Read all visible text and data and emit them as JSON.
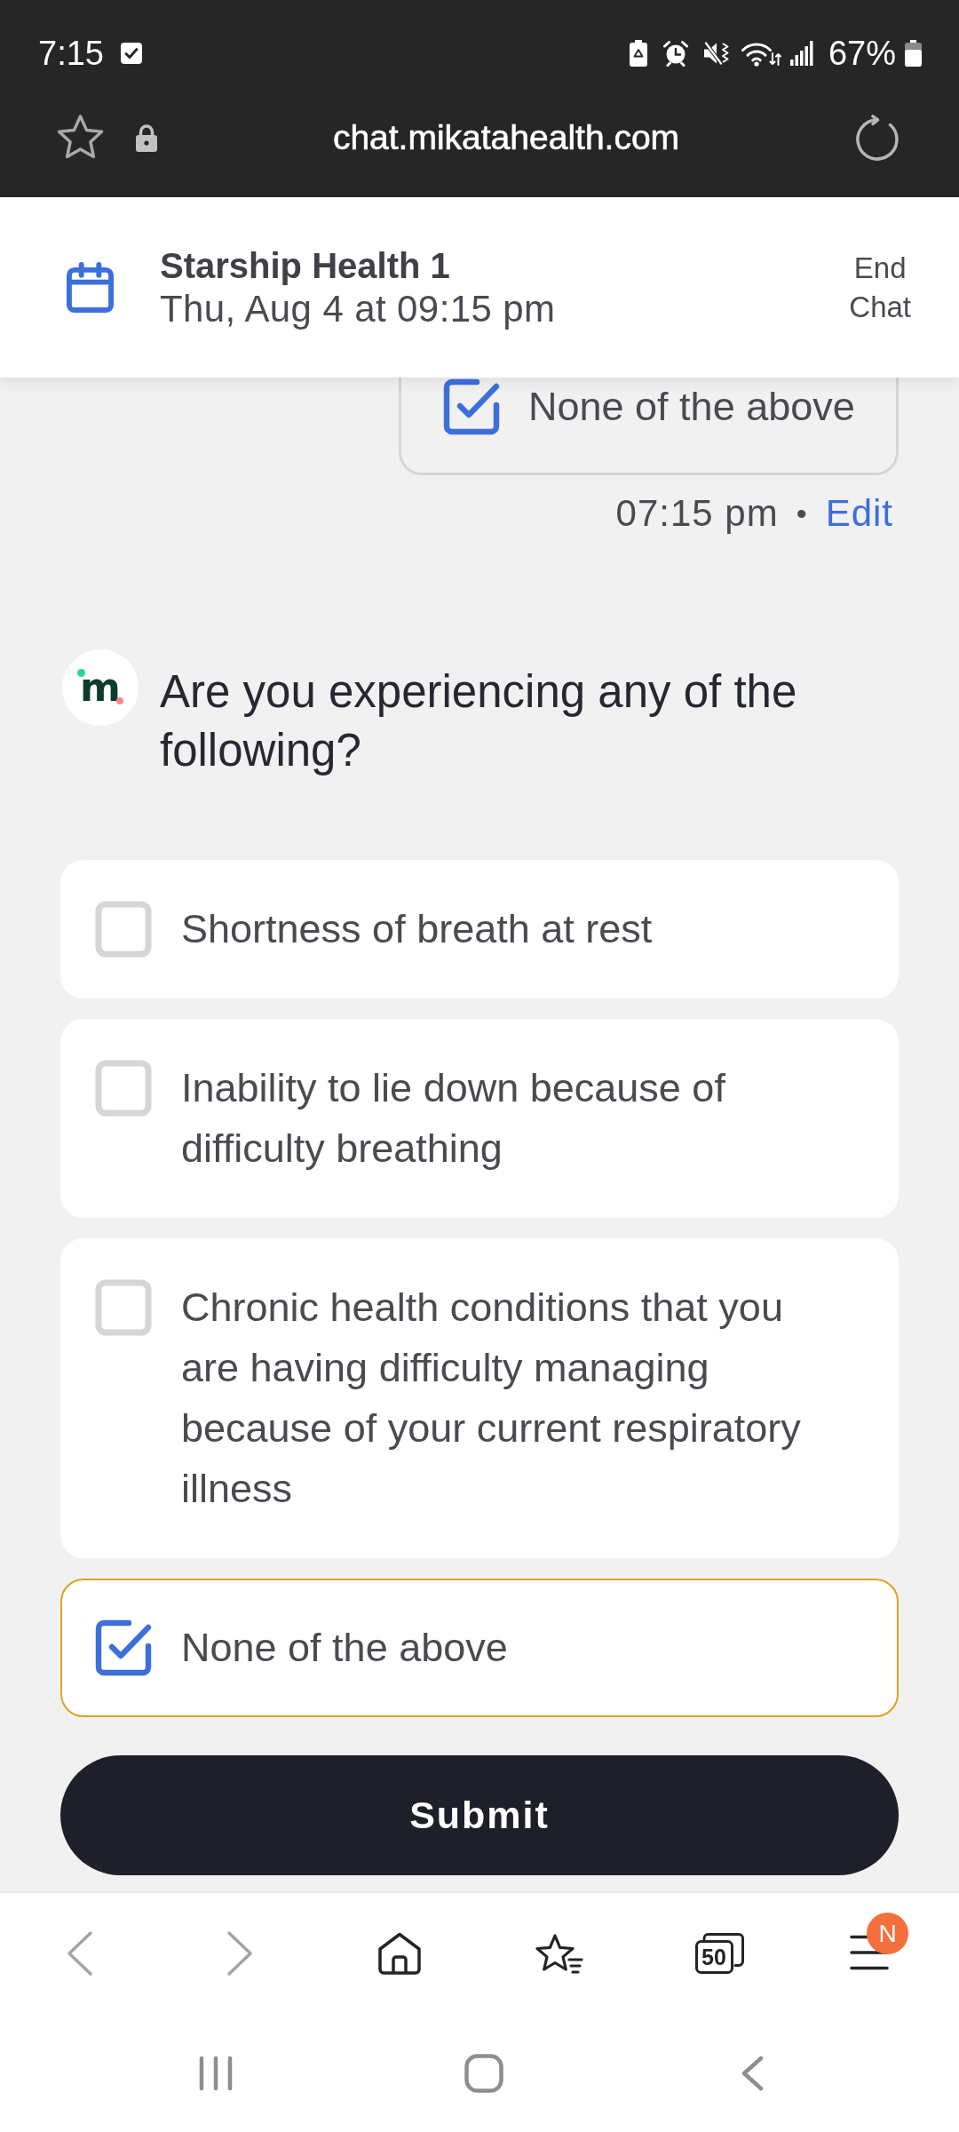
{
  "status_bar": {
    "time": "7:15",
    "battery": "67%"
  },
  "browser_bar": {
    "url": "chat.mikatahealth.com"
  },
  "header": {
    "title": "Starship Health 1",
    "subtitle": "Thu, Aug 4 at 09:15 pm",
    "end_chat": "End Chat"
  },
  "previous_answer": {
    "label": "None of the above",
    "checked": true,
    "time": "07:15 pm",
    "separator": "•",
    "edit": "Edit"
  },
  "question": {
    "avatar_letter": "m",
    "text": "Are you experiencing any of the following?"
  },
  "options": [
    {
      "label": "Shortness of breath at rest",
      "checked": false
    },
    {
      "label": "Inability to lie down because of difficulty breathing",
      "checked": false
    },
    {
      "label": "Chronic health conditions that you are having difficulty managing because of your current respiratory illness",
      "checked": false
    },
    {
      "label": "None of the above",
      "checked": true
    }
  ],
  "submit": {
    "label": "Submit"
  },
  "bottom_nav": [
    {
      "kind": "back",
      "disabled": true
    },
    {
      "kind": "forward",
      "disabled": true
    },
    {
      "kind": "home",
      "disabled": false
    },
    {
      "kind": "bookmarks",
      "disabled": false
    },
    {
      "kind": "tabs",
      "disabled": false,
      "count": "50"
    },
    {
      "kind": "menu",
      "disabled": false,
      "badge": "N"
    }
  ]
}
